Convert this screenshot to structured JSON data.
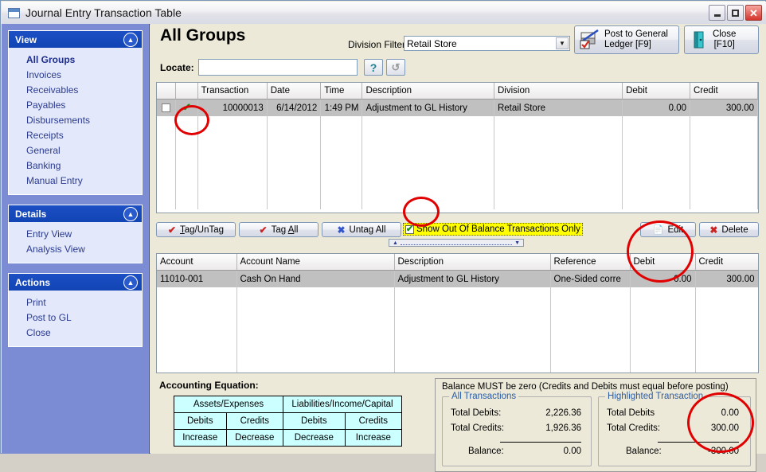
{
  "window": {
    "title": "Journal Entry Transaction Table",
    "controls": {
      "minimize": "–",
      "maximize": "□",
      "close": "✕"
    }
  },
  "sidebar": {
    "sections": [
      {
        "title": "View",
        "items": [
          "All Groups",
          "Invoices",
          "Receivables",
          "Payables",
          "Disbursements",
          "Receipts",
          "General",
          "Banking",
          "Manual Entry"
        ],
        "selected": "All Groups"
      },
      {
        "title": "Details",
        "items": [
          "Entry View",
          "Analysis View"
        ]
      },
      {
        "title": "Actions",
        "items": [
          "Print",
          "Post to GL",
          "Close"
        ]
      }
    ],
    "collapse_glyph": "«"
  },
  "header": {
    "page_title": "All Groups",
    "division_filter_label": "Division Filter:",
    "division_filter_value": "Retail Store",
    "dropdown_glyph": "▼",
    "post_button_line1": "Post to General",
    "post_button_line2": "Ledger [F9]",
    "close_button_line1": "Close",
    "close_button_line2": "[F10]"
  },
  "locate": {
    "label": "Locate:",
    "value": "",
    "placeholder": "",
    "help_glyph": "?",
    "refresh_glyph": "↺"
  },
  "transactions_grid": {
    "columns": [
      "",
      "",
      "Transaction",
      "Date",
      "Time",
      "Description",
      "Division",
      "Debit",
      "Credit"
    ],
    "rows": [
      {
        "tagged": true,
        "transaction": "10000013",
        "date": "6/14/2012",
        "time": "1:49 PM",
        "description": "Adjustment to GL History",
        "division": "Retail Store",
        "debit": "0.00",
        "credit": "300.00",
        "selected": true
      }
    ],
    "check_glyph": "✔"
  },
  "midbar": {
    "tag_untag": {
      "pre": "T",
      "key": "a",
      "post": "g/UnTag"
    },
    "tag_all": {
      "pre": "Tag ",
      "key": "A",
      "post": "ll"
    },
    "untag_all": "Untag All",
    "show_out_of_balance": "Show Out Of Balance Transactions Only",
    "show_out_of_balance_checked": true,
    "edit": "Edit",
    "delete": "Delete",
    "tag_icon": "✔",
    "untag_icon": "✘",
    "edit_icon": "☰",
    "delete_icon": "✖"
  },
  "detail_grid": {
    "columns": [
      "Account",
      "Account Name",
      "Description",
      "Reference",
      "Debit",
      "Credit"
    ],
    "rows": [
      {
        "account": "11010-001",
        "account_name": "Cash On Hand",
        "description": "Adjustment to GL History",
        "reference": "One-Sided corre",
        "debit": "0.00",
        "credit": "300.00",
        "selected": true
      }
    ]
  },
  "accounting_equation": {
    "title": "Accounting Equation:",
    "group_headers": [
      "Assets/Expenses",
      "Liabilities/Income/Capital"
    ],
    "sub_headers": [
      "Debits",
      "Credits",
      "Debits",
      "Credits"
    ],
    "effects": [
      "Increase",
      "Decrease",
      "Decrease",
      "Increase"
    ]
  },
  "balance_panel": {
    "notice": "Balance MUST be zero (Credits and Debits must equal before posting)",
    "all_transactions": {
      "legend": "All Transactions",
      "total_debits_label": "Total Debits:",
      "total_debits_value": "2,226.36",
      "total_credits_label": "Total Credits:",
      "total_credits_value": "1,926.36",
      "balance_label": "Balance:",
      "balance_value": "0.00"
    },
    "highlighted_transaction": {
      "legend": "Highlighted Transaction",
      "total_debits_label": "Total Debits",
      "total_debits_value": "0.00",
      "total_credits_label": "Total Credits:",
      "total_credits_value": "300.00",
      "balance_label": "Balance:",
      "balance_value": "-300.00"
    }
  },
  "colors": {
    "annotation": "#e00000",
    "highlight": "#ffff00",
    "sidebar_bg": "#7b8bd4",
    "panel_header": "#1144b4",
    "grid_selection": "#c0c0c0",
    "equation_bg": "#ccffff"
  }
}
